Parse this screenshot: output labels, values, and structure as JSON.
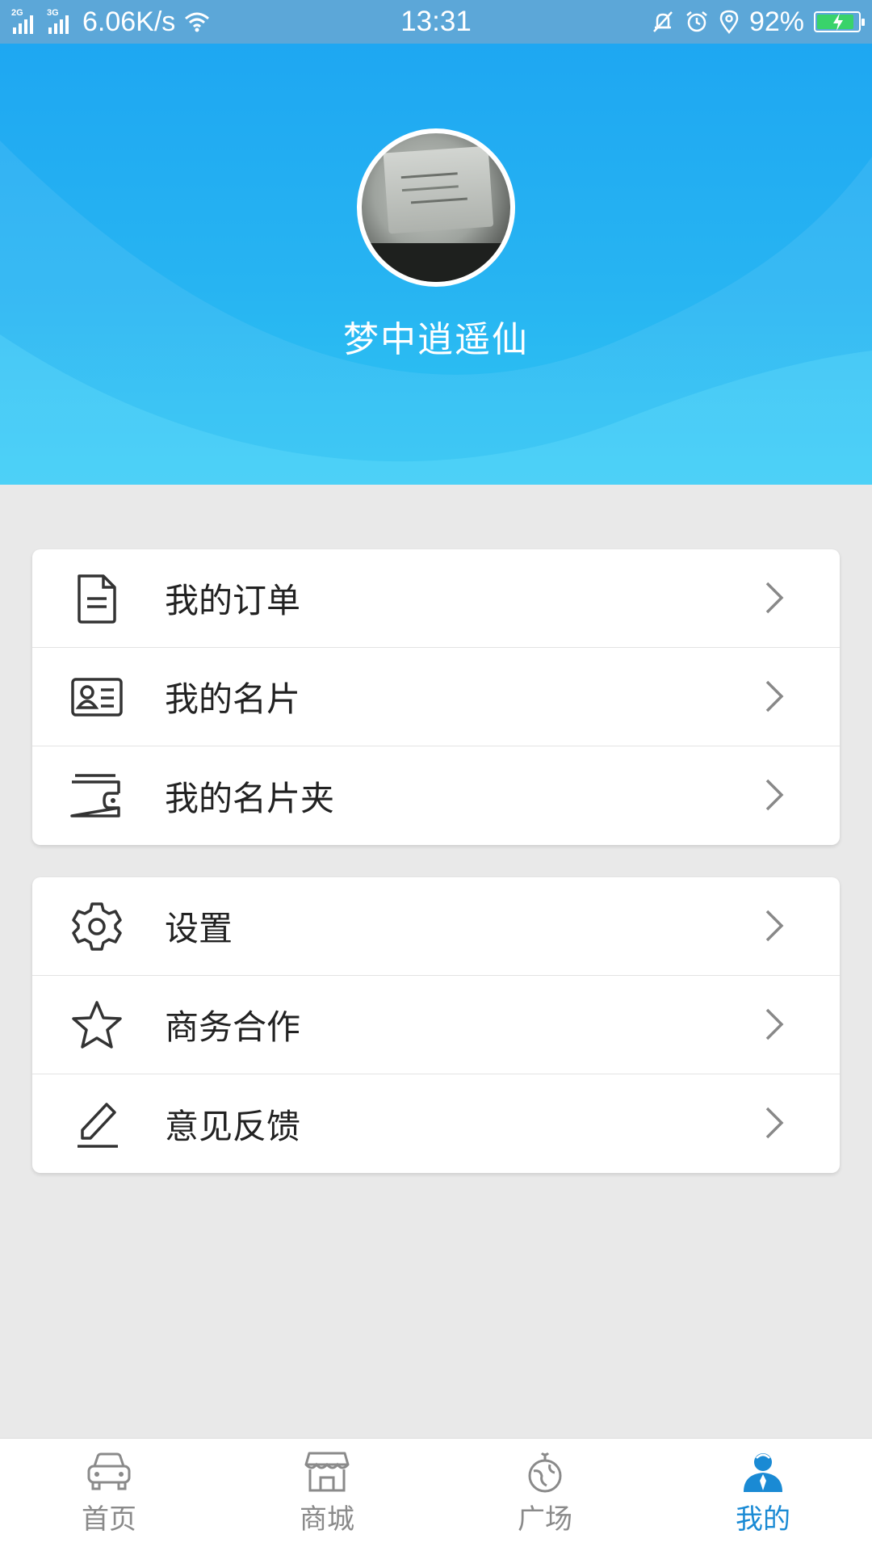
{
  "status_bar": {
    "network_1": "2G",
    "network_2": "3G",
    "speed": "6.06K/s",
    "time": "13:31",
    "battery": "92%",
    "battery_level": 0.92
  },
  "profile": {
    "username": "梦中逍遥仙"
  },
  "menu_group_1": [
    {
      "label": "我的订单",
      "icon": "document-icon"
    },
    {
      "label": "我的名片",
      "icon": "id-card-icon"
    },
    {
      "label": "我的名片夹",
      "icon": "wallet-icon"
    }
  ],
  "menu_group_2": [
    {
      "label": "设置",
      "icon": "gear-icon"
    },
    {
      "label": "商务合作",
      "icon": "star-icon"
    },
    {
      "label": "意见反馈",
      "icon": "pen-icon"
    }
  ],
  "bottom_nav": [
    {
      "label": "首页",
      "icon": "car-icon",
      "active": false
    },
    {
      "label": "商城",
      "icon": "shop-icon",
      "active": false
    },
    {
      "label": "广场",
      "icon": "globe-icon",
      "active": false
    },
    {
      "label": "我的",
      "icon": "person-icon",
      "active": true
    }
  ],
  "colors": {
    "header_top": "#1ea7f2",
    "header_bottom": "#2fc6f3",
    "accent": "#1a8ad4",
    "background": "#e9e9e9"
  }
}
